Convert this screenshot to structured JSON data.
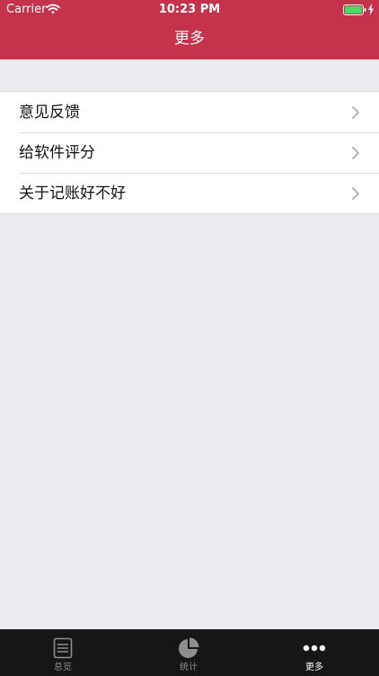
{
  "status_bar": {
    "carrier": "Carrier",
    "time": "10:23 PM",
    "wifi_icon": "wifi-icon",
    "battery_icon": "battery-full-icon",
    "charging_icon": "charging-bolt-icon"
  },
  "nav": {
    "title": "更多",
    "background_color": "#c4334b"
  },
  "menu": {
    "items": [
      {
        "label": "意见反馈",
        "icon": "chevron-right-icon"
      },
      {
        "label": "给软件评分",
        "icon": "chevron-right-icon"
      },
      {
        "label": "关于记账好不好",
        "icon": "chevron-right-icon"
      }
    ]
  },
  "tabbar": {
    "items": [
      {
        "label": "总览",
        "icon": "list-document-icon",
        "active": false
      },
      {
        "label": "统计",
        "icon": "pie-chart-icon",
        "active": false
      },
      {
        "label": "更多",
        "icon": "more-dots-icon",
        "active": true
      }
    ]
  },
  "colors": {
    "accent": "#c4334b",
    "page_background": "#ebebf1",
    "tabbar_background": "#161616",
    "battery_fill": "#4cd964"
  }
}
